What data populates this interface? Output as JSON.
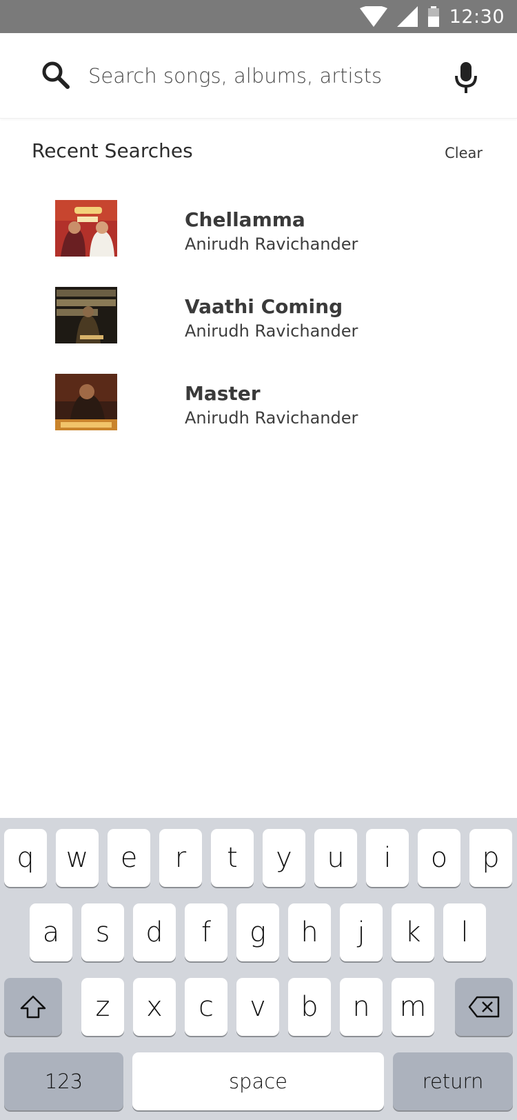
{
  "status_bar": {
    "time": "12:30"
  },
  "search": {
    "placeholder": "Search songs, albums, artists"
  },
  "recent": {
    "title": "Recent Searches",
    "clear_label": "Clear",
    "items": [
      {
        "title": "Chellamma",
        "artist": "Anirudh Ravichander"
      },
      {
        "title": "Vaathi Coming",
        "artist": "Anirudh Ravichander"
      },
      {
        "title": "Master",
        "artist": "Anirudh Ravichander"
      }
    ]
  },
  "keyboard": {
    "row1": [
      "q",
      "w",
      "e",
      "r",
      "t",
      "y",
      "u",
      "i",
      "o",
      "p"
    ],
    "row2": [
      "a",
      "s",
      "d",
      "f",
      "g",
      "h",
      "j",
      "k",
      "l"
    ],
    "row3": [
      "z",
      "x",
      "c",
      "v",
      "b",
      "n",
      "m"
    ],
    "numbers_label": "123",
    "space_label": "space",
    "return_label": "return"
  }
}
